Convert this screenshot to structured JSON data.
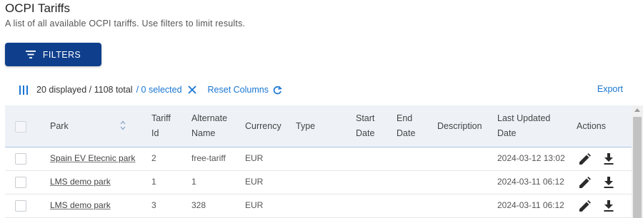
{
  "page": {
    "title": "OCPI Tariffs",
    "subtitle": "A list of all available OCPI tariffs. Use filters to limit results."
  },
  "filters_button": {
    "label": "FILTERS",
    "icon": "filter-lines-icon"
  },
  "toolbar": {
    "displayed": "20 displayed / 1108 total",
    "selected": "/ 0 selected",
    "reset_columns": "Reset Columns",
    "export": "Export"
  },
  "columns": {
    "park": "Park",
    "tariff_id": [
      "Tariff",
      "Id"
    ],
    "alternate_name": [
      "Alternate",
      "Name"
    ],
    "currency": "Currency",
    "type": "Type",
    "start_date": [
      "Start",
      "Date"
    ],
    "end_date": [
      "End",
      "Date"
    ],
    "description": "Description",
    "last_updated": [
      "Last Updated",
      "Date"
    ],
    "actions": "Actions"
  },
  "rows": [
    {
      "park": "Spain EV Etecnic park",
      "tariff_id": "2",
      "alternate_name": "free-tariff",
      "currency": "EUR",
      "type": "",
      "start_date": "",
      "end_date": "",
      "description": "",
      "last_updated": "2024-03-12 13:02"
    },
    {
      "park": "LMS demo park",
      "tariff_id": "1",
      "alternate_name": "1",
      "currency": "EUR",
      "type": "",
      "start_date": "",
      "end_date": "",
      "description": "",
      "last_updated": "2024-03-11 06:12"
    },
    {
      "park": "LMS demo park",
      "tariff_id": "3",
      "alternate_name": "328",
      "currency": "EUR",
      "type": "",
      "start_date": "",
      "end_date": "",
      "description": "",
      "last_updated": "2024-03-11 06:12"
    }
  ],
  "colors": {
    "primary_button": "#0f3f8c",
    "link": "#1976d2",
    "header_bg": "#eef2f7"
  }
}
